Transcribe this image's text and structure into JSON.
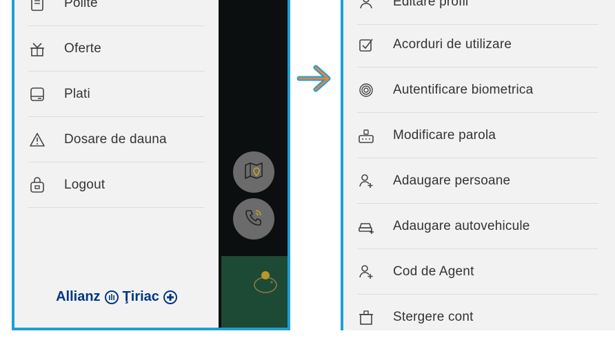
{
  "left_menu": {
    "items": [
      {
        "label": "Polite",
        "icon": "policy-document-icon"
      },
      {
        "label": "Oferte",
        "icon": "gift-box-icon"
      },
      {
        "label": "Plati",
        "icon": "card-payment-icon"
      },
      {
        "label": "Dosare de dauna",
        "icon": "warning-triangle-icon"
      },
      {
        "label": "Logout",
        "icon": "logout-icon"
      }
    ],
    "logo_left": "Allianz",
    "logo_right": "Ţiriac"
  },
  "right_menu": {
    "items": [
      {
        "label": "Editare profil",
        "icon": "profile-edit-icon"
      },
      {
        "label": "Acorduri de utilizare",
        "icon": "checkbox-icon"
      },
      {
        "label": "Autentificare biometrica",
        "icon": "fingerprint-icon"
      },
      {
        "label": "Modificare parola",
        "icon": "password-lock-icon"
      },
      {
        "label": "Adaugare persoane",
        "icon": "add-person-icon"
      },
      {
        "label": "Adaugare autovehicule",
        "icon": "add-car-icon"
      },
      {
        "label": "Cod de Agent",
        "icon": "agent-code-icon"
      },
      {
        "label": "Stergere cont",
        "icon": "delete-account-icon"
      }
    ]
  },
  "colors": {
    "border_accent": "#1e9fd6",
    "arrow_orange": "#e8833a",
    "logo_blue": "#003781"
  }
}
